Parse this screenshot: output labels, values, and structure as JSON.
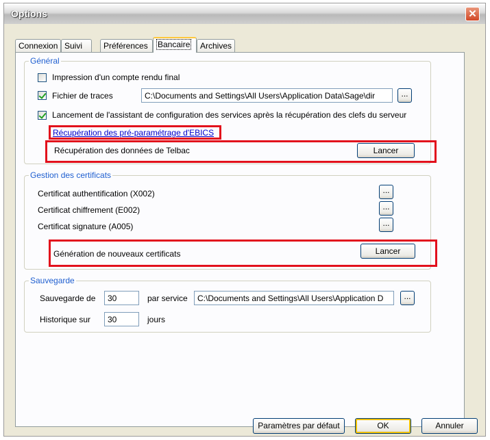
{
  "window": {
    "title": "Options",
    "close_label": "✕"
  },
  "tabs": [
    {
      "label": "Connexion"
    },
    {
      "label": "Suivi"
    },
    {
      "label": "Préférences"
    },
    {
      "label": "Bancaire"
    },
    {
      "label": "Archives"
    }
  ],
  "active_tab": "Bancaire",
  "general": {
    "legend": "Général",
    "print_report": {
      "label": "Impression d'un compte rendu final",
      "checked": false
    },
    "trace_file": {
      "label": "Fichier de traces",
      "checked": true,
      "value": "C:\\Documents and Settings\\All Users\\Application Data\\Sage\\dir",
      "browse": "..."
    },
    "launch_wizard": {
      "label": "Lancement de l'assistant de configuration des services après la récupération des clefs du serveur",
      "checked": true
    },
    "ebics_link": "Récupération des pré-paramétrage d'EBICS",
    "telbac": {
      "label": "Récupération des données de Telbac",
      "button": "Lancer"
    }
  },
  "certificates": {
    "legend": "Gestion des certificats",
    "auth": {
      "label": "Certificat authentification (X002)",
      "browse": "..."
    },
    "encrypt": {
      "label": "Certificat chiffrement (E002)",
      "browse": "..."
    },
    "signature": {
      "label": "Certificat signature (A005)",
      "browse": "..."
    },
    "generate": {
      "label": "Génération de nouveaux certificats",
      "button": "Lancer"
    }
  },
  "backup": {
    "legend": "Sauvegarde",
    "backup_label": "Sauvegarde de",
    "backup_value": "30",
    "per_service": "par service",
    "path_value": "C:\\Documents and Settings\\All Users\\Application D",
    "browse": "...",
    "history_label": "Historique sur",
    "history_value": "30",
    "days": "jours"
  },
  "footer": {
    "defaults": "Paramètres par défaut",
    "ok": "OK",
    "cancel": "Annuler"
  },
  "colors": {
    "highlight": "#e2101c",
    "legend": "#1f5fd0",
    "link": "#0000cc"
  }
}
